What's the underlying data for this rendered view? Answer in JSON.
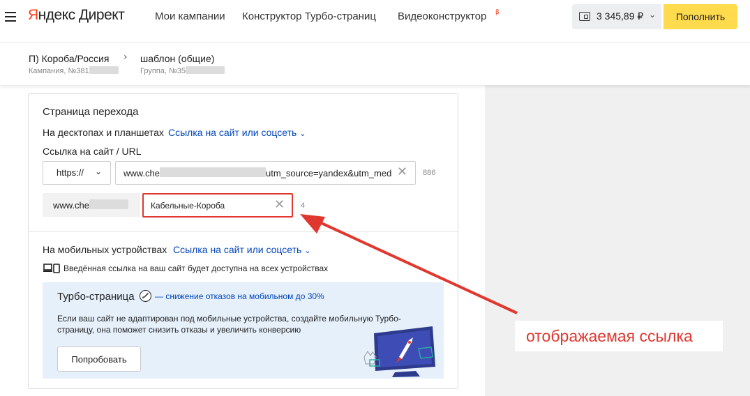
{
  "header": {
    "logo": "Яндекс Директ",
    "nav": [
      "Мои кампании",
      "Конструктор Турбо-страниц",
      "Видеоконструктор"
    ],
    "beta": "β",
    "balance": "3 345,89 ₽",
    "topup_label": "Пополнить"
  },
  "breadcrumbs": {
    "campaign_title": "П) Короба/Россия",
    "campaign_sub": "Кампания, №381",
    "group_title": "шаблон (общие)",
    "group_sub": "Группа, №35"
  },
  "form": {
    "section_title": "Страница перехода",
    "desktop_label": "На десктопах и планшетах",
    "desktop_link": "Ссылка на сайт или соцсеть",
    "url_label": "Ссылка на сайт / URL",
    "protocol": "https://",
    "url_prefix": "www.che",
    "url_suffix": "utm_source=yandex&utm_med",
    "url_counter": "886",
    "display_prefix": "www.che",
    "display_value": "Кабельные-Короба",
    "display_counter": "4",
    "mobile_label": "На мобильных устройствах",
    "mobile_link": "Ссылка на сайт или соцсеть",
    "all_devices_note": "Введённая ссылка на ваш сайт будет доступна на всех устройствах"
  },
  "promo": {
    "title": "Турбо-страница",
    "subtitle": "— снижение отказов на мобильном до 30%",
    "text_line1": "Если ваш сайт не адаптирован под мобильные устройства, создайте мобильную Турбо-",
    "text_line2": "страницу, она поможет снизить отказы и увеличить конверсию",
    "button": "Попробовать"
  },
  "annotation": "отображаемая ссылка",
  "colors": {
    "accent_yellow": "#ffdb4d",
    "link_blue": "#0044bb",
    "highlight_red": "#e0372f",
    "promo_bg": "#e6f0fb"
  },
  "icons": [
    "burger-menu-icon",
    "wallet-icon",
    "chevron-down-icon",
    "chevron-right-icon",
    "clear-icon",
    "devices-icon",
    "rocket-icon"
  ]
}
